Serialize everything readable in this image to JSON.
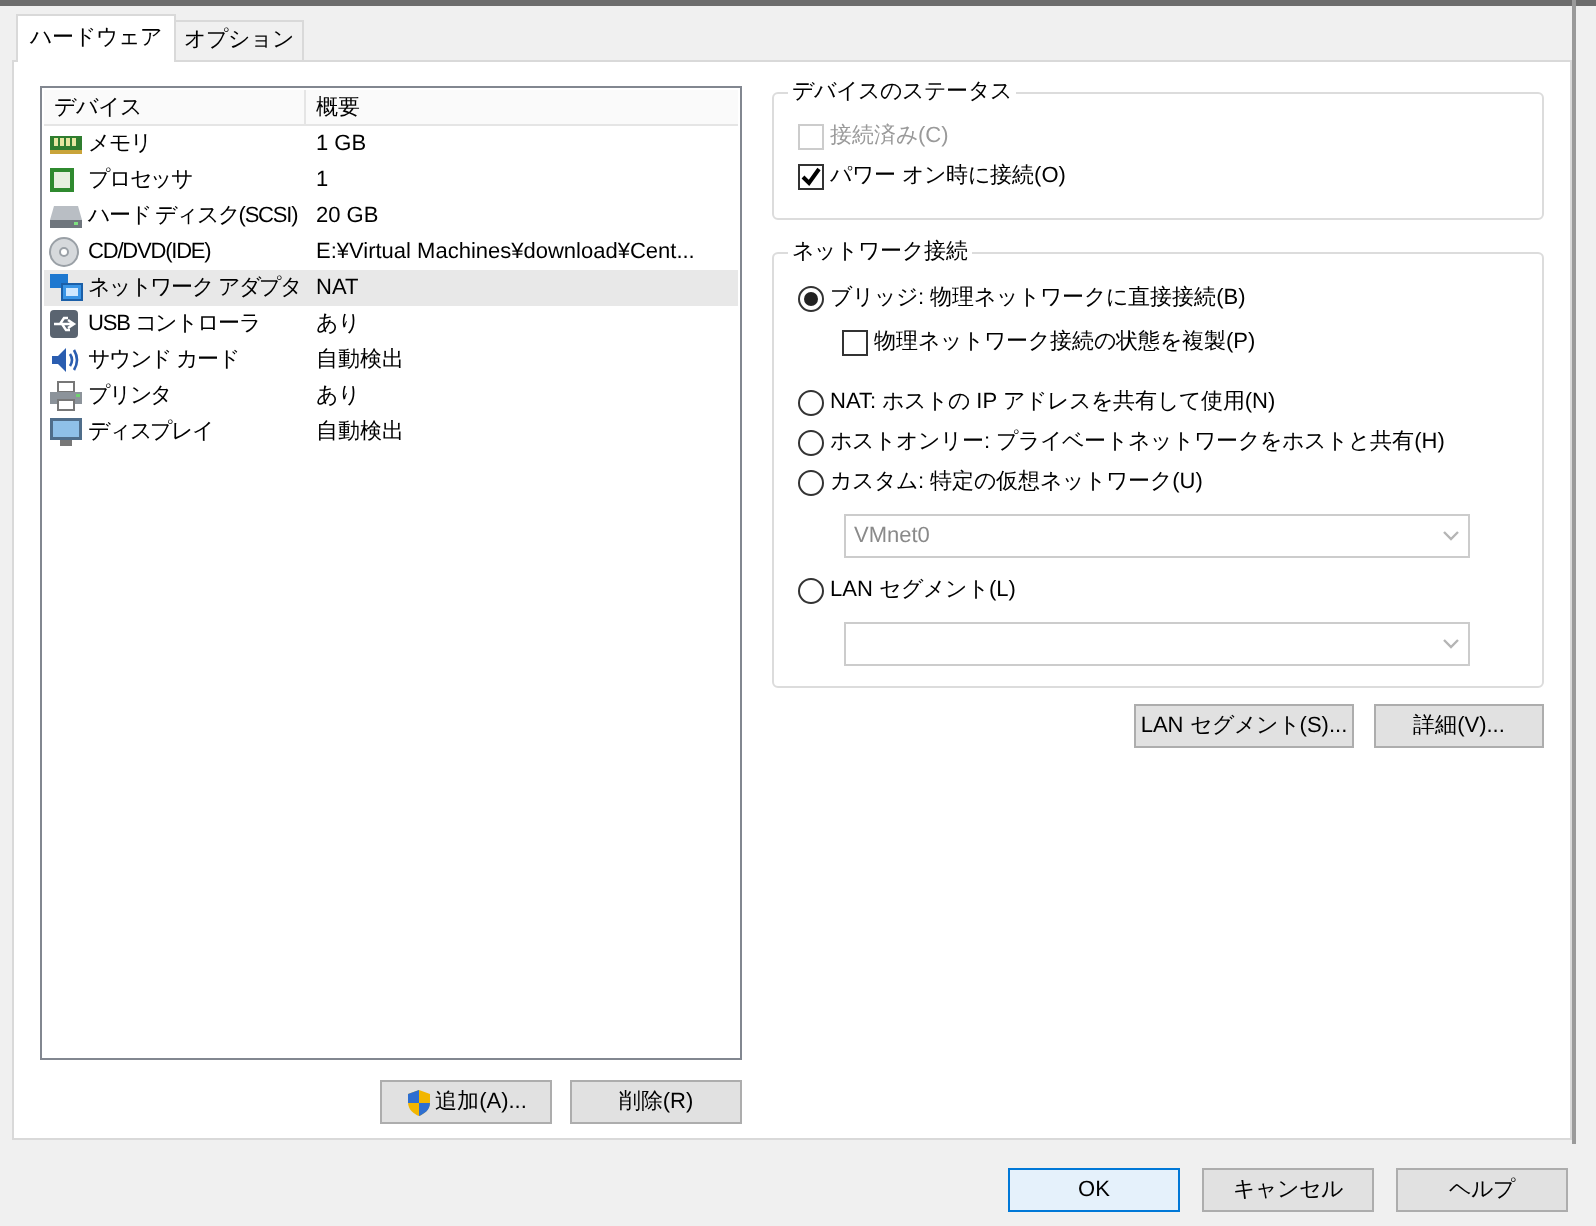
{
  "tabs": [
    {
      "label": "ハードウェア",
      "selected": true
    },
    {
      "label": "オプション",
      "selected": false
    }
  ],
  "device_list": {
    "columns": [
      "デバイス",
      "概要"
    ],
    "rows": [
      {
        "device": "メモリ",
        "summary": "1 GB",
        "selected": false
      },
      {
        "device": "プロセッサ",
        "summary": "1",
        "selected": false
      },
      {
        "device": "ハード ディスク(SCSI)",
        "summary": "20 GB",
        "selected": false
      },
      {
        "device": "CD/DVD(IDE)",
        "summary": "E:¥Virtual Machines¥download¥Cent...",
        "selected": false
      },
      {
        "device": "ネットワーク アダプタ",
        "summary": "NAT",
        "selected": true
      },
      {
        "device": "USB コントローラ",
        "summary": "あり",
        "selected": false
      },
      {
        "device": "サウンド カード",
        "summary": "自動検出",
        "selected": false
      },
      {
        "device": "プリンタ",
        "summary": "あり",
        "selected": false
      },
      {
        "device": "ディスプレイ",
        "summary": "自動検出",
        "selected": false
      }
    ]
  },
  "list_buttons": [
    {
      "label": "追加(A)...",
      "shield": true
    },
    {
      "label": "削除(R)",
      "shield": false
    }
  ],
  "device_status": {
    "title": "デバイスのステータス",
    "options": [
      {
        "label": "接続済み(C)",
        "checked": false,
        "disabled": true
      },
      {
        "label": "パワー オン時に接続(O)",
        "checked": true,
        "disabled": false
      }
    ]
  },
  "network": {
    "title": "ネットワーク接続",
    "items": [
      {
        "kind": "radio",
        "label": "ブリッジ: 物理ネットワークに直接接続(B)",
        "selected": true
      },
      {
        "kind": "checkbox",
        "label": "物理ネットワーク接続の状態を複製(P)",
        "checked": false
      },
      {
        "kind": "radio",
        "label": "NAT: ホストの IP アドレスを共有して使用(N)",
        "selected": false
      },
      {
        "kind": "radio",
        "label": "ホストオンリー: プライベートネットワークをホストと共有(H)",
        "selected": false
      },
      {
        "kind": "radio",
        "label": "カスタム: 特定の仮想ネットワーク(U)",
        "selected": false
      },
      {
        "kind": "dropdown",
        "value": "VMnet0",
        "disabled": true
      },
      {
        "kind": "radio",
        "label": "LAN セグメント(L)",
        "selected": false
      },
      {
        "kind": "dropdown",
        "disabled": true
      }
    ]
  },
  "panel_buttons": [
    {
      "label": "LAN セグメント(S)..."
    },
    {
      "label": "詳細(V)..."
    }
  ],
  "dialog_buttons": [
    {
      "label": "OK",
      "default": true
    },
    {
      "label": "キャンセル",
      "default": false
    },
    {
      "label": "ヘルプ",
      "default": false
    }
  ]
}
